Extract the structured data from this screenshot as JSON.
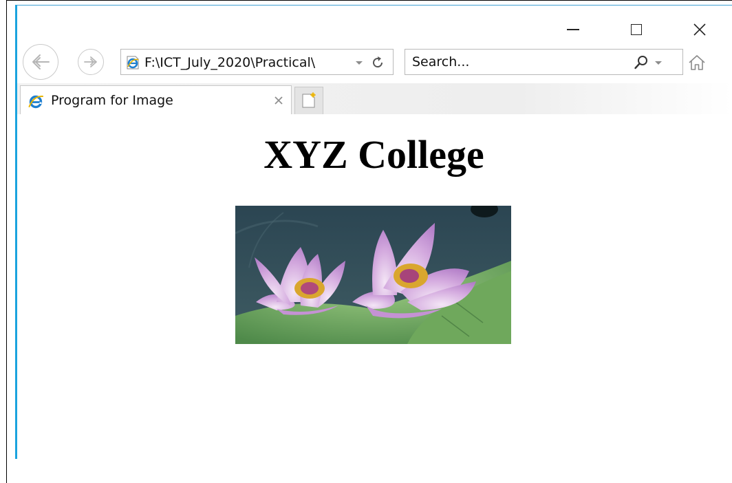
{
  "window": {
    "controls": {
      "minimize": "minimize-icon",
      "maximize": "maximize-icon",
      "close": "close-icon"
    }
  },
  "navigation": {
    "back_icon": "back-arrow-icon",
    "forward_icon": "forward-arrow-icon",
    "address": "F:\\ICT_July_2020\\Practical\\",
    "search_placeholder": "Search..."
  },
  "tabs": [
    {
      "title": "Program for Image",
      "icon": "ie-logo-icon",
      "active": true
    }
  ],
  "page": {
    "heading": "XYZ College",
    "image": {
      "subject": "two pink lotus flowers on green leaves"
    }
  },
  "colors": {
    "window_border": "#1aa3de",
    "tabstrip_bg": "#eeeeee",
    "ie_blue": "#1e7fd0",
    "ie_gold": "#e7b400"
  }
}
